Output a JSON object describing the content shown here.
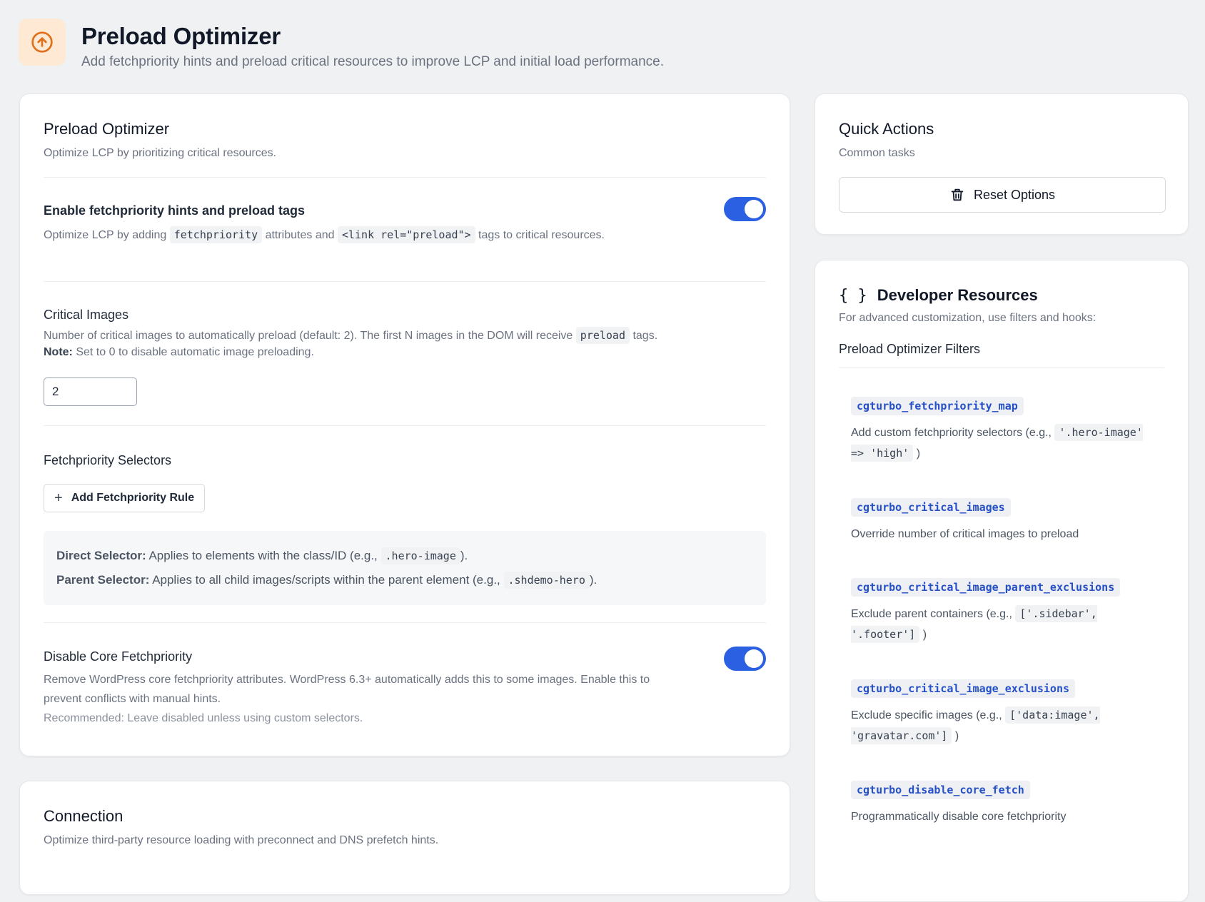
{
  "header": {
    "title": "Preload Optimizer",
    "subtitle": "Add fetchpriority hints and preload critical resources to improve LCP and initial load performance.",
    "icon": "arrow-up-circle-icon",
    "accent": "#e0701c"
  },
  "main": {
    "title": "Preload Optimizer",
    "desc": "Optimize LCP by prioritizing critical resources.",
    "enable": {
      "title": "Enable fetchpriority hints and preload tags",
      "desc_1": "Optimize LCP by adding",
      "code_1": "fetchpriority",
      "desc_2": "attributes and",
      "code_2": "<link rel=\"preload\">",
      "desc_3": "tags to critical resources.",
      "on": true
    },
    "critical": {
      "title": "Critical Images",
      "desc_1": "Number of critical images to automatically preload (default: 2). The first N images in the DOM will receive",
      "code": "preload",
      "desc_2": "tags.",
      "note_label": "Note:",
      "note_text": "Set to 0 to disable automatic image preloading.",
      "value": "2"
    },
    "selectors": {
      "title": "Fetchpriority Selectors",
      "add_label": "Add Fetchpriority Rule",
      "direct_label": "Direct Selector:",
      "direct_text": "Applies to elements with the class/ID (e.g.,",
      "direct_code": ".hero-image",
      "direct_end": ").",
      "parent_label": "Parent Selector:",
      "parent_text": "Applies to all child images/scripts within the parent element (e.g.,",
      "parent_code": ".shdemo-hero",
      "parent_end": ")."
    },
    "core": {
      "title": "Disable Core Fetchpriority",
      "desc": "Remove WordPress core fetchpriority attributes. WordPress 6.3+ automatically adds this to some images. Enable this to prevent conflicts with manual hints.",
      "recommend": "Recommended: Leave disabled unless using custom selectors.",
      "on": true
    }
  },
  "connection": {
    "title": "Connection",
    "desc": "Optimize third-party resource loading with preconnect and DNS prefetch hints."
  },
  "quick": {
    "title": "Quick Actions",
    "desc": "Common tasks",
    "reset_label": "Reset Options"
  },
  "dev": {
    "icon_text": "{ }",
    "title": "Developer Resources",
    "desc": "For advanced customization, use filters and hooks:",
    "filters_title": "Preload Optimizer Filters",
    "filters": [
      {
        "name": "cgturbo_fetchpriority_map",
        "desc": "Add custom fetchpriority selectors (e.g.,",
        "code": "'.hero-image' => 'high'",
        "end": ")"
      },
      {
        "name": "cgturbo_critical_images",
        "desc": "Override number of critical images to preload",
        "code": "",
        "end": ""
      },
      {
        "name": "cgturbo_critical_image_parent_exclusions",
        "desc": "Exclude parent containers (e.g.,",
        "code": "['.sidebar', '.footer']",
        "end": ")"
      },
      {
        "name": "cgturbo_critical_image_exclusions",
        "desc": "Exclude specific images (e.g.,",
        "code": "['data:image', 'gravatar.com']",
        "end": ")"
      },
      {
        "name": "cgturbo_disable_core_fetch",
        "desc": "Programmatically disable core fetchpriority",
        "code": "",
        "end": ""
      }
    ]
  }
}
